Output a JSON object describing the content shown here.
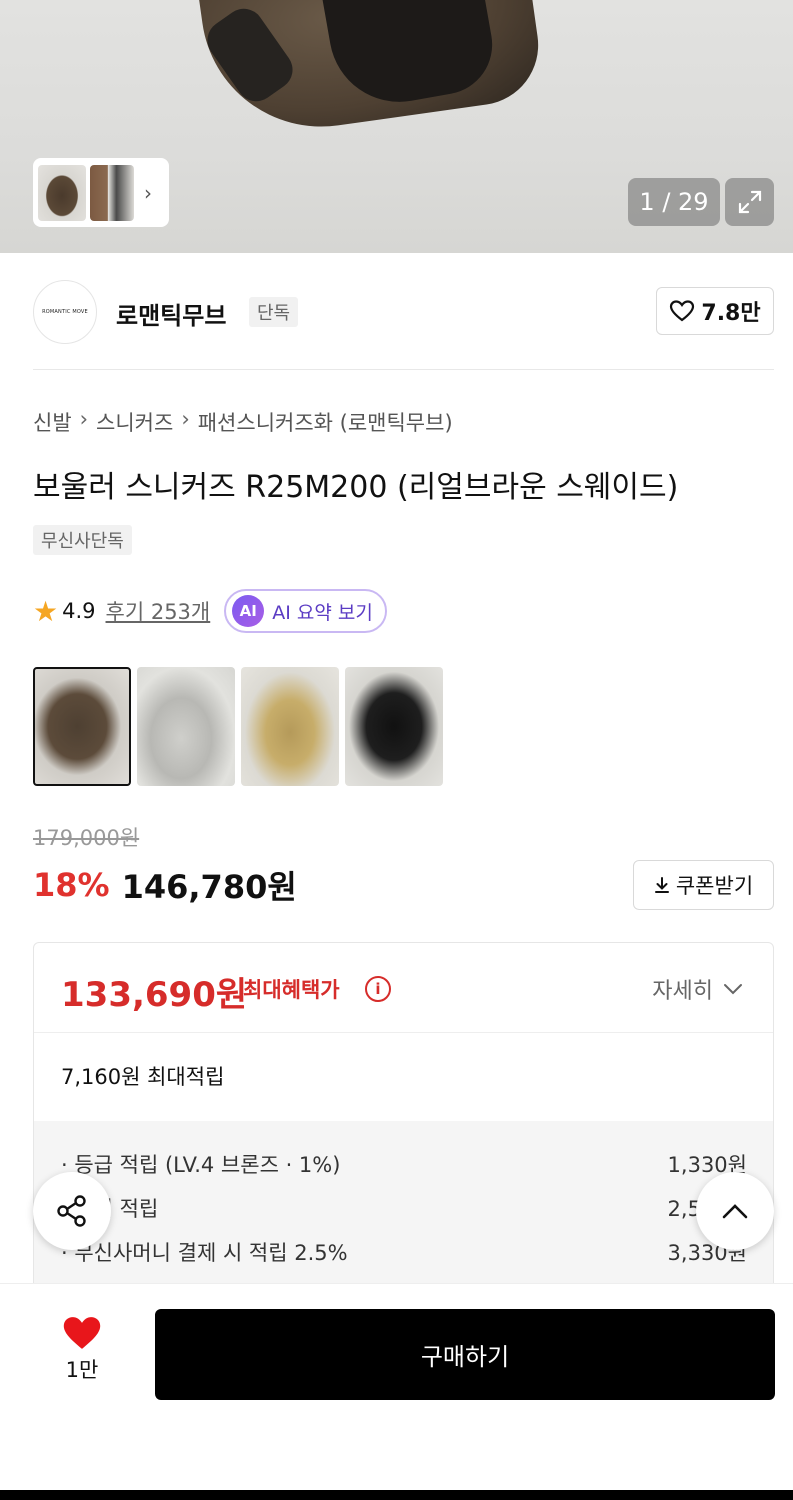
{
  "hero": {
    "counter": "1 / 29"
  },
  "brand": {
    "logo_text": "ROMANTIC MOVE",
    "name": "로맨틱무브",
    "badge": "단독",
    "like_count": "7.8만"
  },
  "breadcrumb": [
    "신발",
    "스니커즈",
    "패션스니커즈화 (로맨틱무브)"
  ],
  "product": {
    "title": "보울러 스니커즈 R25M200 (리얼브라운 스웨이드)",
    "exclusive_badge": "무신사단독",
    "rating": "4.9",
    "review_link": "후기 253개",
    "ai_icon": "AI",
    "ai_label": "AI 요약 보기",
    "variants": [
      {
        "name": "brown-suede",
        "selected": true
      },
      {
        "name": "white",
        "selected": false
      },
      {
        "name": "beige",
        "selected": false
      },
      {
        "name": "black",
        "selected": false
      }
    ]
  },
  "price": {
    "original": "179,000원",
    "discount": "18%",
    "current": "146,780원",
    "coupon_label": "쿠폰받기"
  },
  "benefit": {
    "max_price": "133,690원",
    "max_label": "최대혜택가",
    "detail_label": "자세히",
    "points_summary": "7,160원 최대적립",
    "rows": [
      {
        "label": "· 등급 적립 (LV.4 브론즈 · 1%)",
        "value": "1,330원"
      },
      {
        "label": "· 후기 적립",
        "value": "2,500원"
      },
      {
        "label": "· 무신사머니 결제 시 적립 2.5%",
        "value": "3,330원"
      }
    ]
  },
  "bottom": {
    "wish_count": "1만",
    "buy_label": "구매하기"
  },
  "colors": {
    "accent_red": "#e0322e",
    "benefit_red": "#d62c2a",
    "ai_purple": "#7b5cf0",
    "star": "#f5a623"
  }
}
